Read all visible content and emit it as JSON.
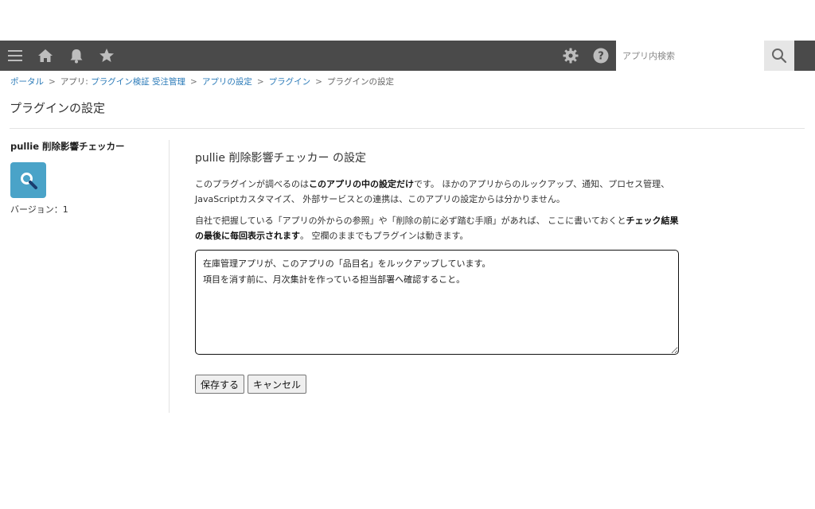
{
  "topbar": {
    "icons": {
      "menu": "menu-icon",
      "home": "home-icon",
      "notifications": "bell-icon",
      "favorites": "star-icon",
      "settings": "gear-icon",
      "help": "help-icon",
      "search": "search-icon"
    },
    "search_placeholder": "アプリ内検索",
    "background_color": "#4a4a4a"
  },
  "breadcrumb": {
    "portal": "ポータル",
    "app_prefix": "アプリ: ",
    "app_name": "プラグイン検証 受注管理",
    "app_settings": "アプリの設定",
    "plugins": "プラグイン",
    "current": "プラグインの設定",
    "separator": ">"
  },
  "page": {
    "title": "プラグインの設定"
  },
  "sidebar": {
    "plugin_name": "pullie 削除影響チェッカー",
    "plugin_icon": "magnifier-icon",
    "icon_color": "#4aa3c8",
    "version": "バージョン：1"
  },
  "main": {
    "section_title": "pullie 削除影響チェッカー の設定",
    "p1": {
      "before": "このプラグインが調べるのは",
      "bold": "このアプリの中の設定だけ",
      "after": "です。 ほかのアプリからのルックアップ、通知、プロセス管理、JavaScriptカスタマイズ、 外部サービスとの連携は、このアプリの設定からは分かりません。"
    },
    "p2": {
      "before": "自社で把握している「アプリの外からの参照」や「削除の前に必ず踏む手順」があれば、 ここに書いておくと",
      "bold": "チェック結果の最後に毎回表示されます",
      "after": "。 空欄のままでもプラグインは動きます。"
    },
    "notes_value": "在庫管理アプリが、このアプリの「品目名」をルックアップしています。\n項目を消す前に、月次集計を作っている担当部署へ確認すること。",
    "save_label": "保存する",
    "cancel_label": "キャンセル"
  }
}
